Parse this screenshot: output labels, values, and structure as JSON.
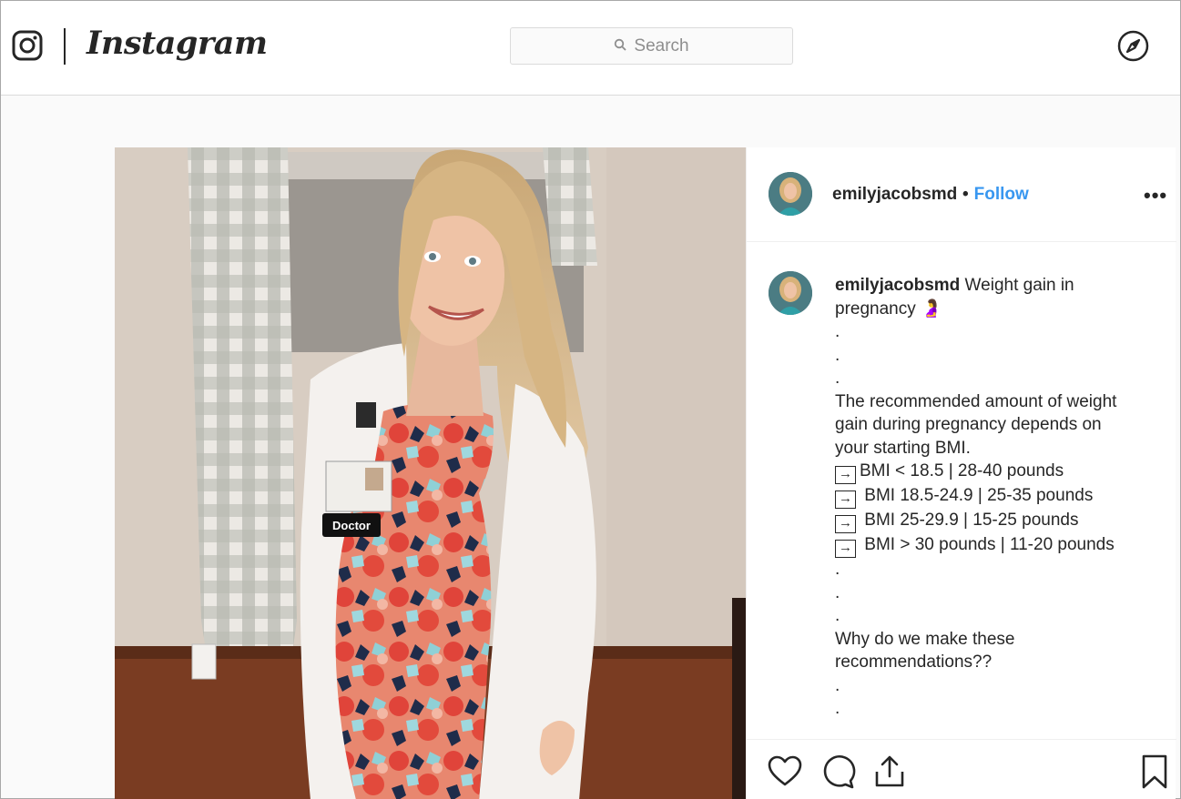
{
  "header": {
    "brand_name": "Instagram",
    "search_placeholder": "Search",
    "icons": {
      "logo": "instagram-glyph-icon",
      "search": "search-icon",
      "explore": "compass-icon"
    }
  },
  "post": {
    "username": "emilyjacobsmd",
    "separator": "•",
    "follow_label": "Follow",
    "more_label": "•••",
    "photo": {
      "badge_text": "Doctor",
      "subject": "woman in white coat and floral dress"
    },
    "caption": {
      "username": "emilyjacobsmd",
      "first_text": " Weight gain in",
      "second_line": "pregnancy 🤰",
      "dots_a": [
        ".",
        " .",
        "."
      ],
      "paragraph_lines": [
        "The recommended amount of weight",
        "gain during pregnancy depends on",
        "your starting BMI."
      ],
      "arrow_glyph": "→",
      "bmi_lines": [
        "BMI < 18.5 | 28-40 pounds",
        " BMI 18.5-24.9 | 25-35 pounds",
        " BMI 25-29.9 | 15-25 pounds",
        " BMI > 30 pounds | 11-20 pounds"
      ],
      "dots_b": [
        ".",
        ".",
        "."
      ],
      "question_lines": [
        "Why do we make these",
        "recommendations??"
      ],
      "dots_c": [
        ".",
        "."
      ]
    },
    "actions": {
      "like": "heart-icon",
      "comment": "comment-icon",
      "share": "share-icon",
      "save": "bookmark-icon"
    },
    "colors": {
      "accent": "#3897f0",
      "text": "#262626",
      "border": "#dbdbdb"
    }
  }
}
